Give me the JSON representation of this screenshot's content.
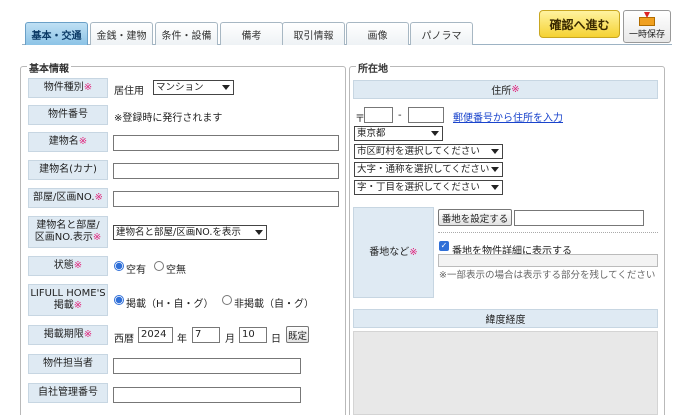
{
  "tabs": [
    {
      "label": "基本・交通",
      "active": true
    },
    {
      "label": "金銭・建物"
    },
    {
      "label": "条件・設備"
    },
    {
      "label": "備考"
    },
    {
      "label": "取引情報"
    },
    {
      "label": "画像"
    },
    {
      "label": "パノラマ"
    }
  ],
  "toolbar": {
    "confirm_label": "確認へ進む",
    "save_label": "一時保存"
  },
  "basic": {
    "legend": "基本情報",
    "property_type": {
      "label": "物件種別",
      "prefix": "居住用",
      "value": "マンション"
    },
    "property_number": {
      "label": "物件番号",
      "value": "※登録時に発行されます"
    },
    "building_name": {
      "label": "建物名",
      "value": ""
    },
    "building_name_kana": {
      "label": "建物名(カナ)",
      "value": ""
    },
    "room_number": {
      "label": "部屋/区画NO.",
      "value": ""
    },
    "display": {
      "label_line1": "建物名と部屋/",
      "label_line2": "区画NO.表示",
      "value": "建物名と部屋/区画NO.を表示"
    },
    "status": {
      "label": "状態",
      "opt1": "空有",
      "opt2": "空無"
    },
    "lifull": {
      "label_line1": "LIFULL HOME'S",
      "label_line2": "掲載",
      "opt1": "掲載（H・自・グ）",
      "opt2": "非掲載（自・グ）"
    },
    "period": {
      "label": "掲載期限",
      "era": "西暦",
      "year": "2024",
      "year_unit": "年",
      "month": "7",
      "month_unit": "月",
      "day": "10",
      "day_unit": "日",
      "default_btn": "既定"
    },
    "person": {
      "label": "物件担当者",
      "value": ""
    },
    "mgmt_no": {
      "label": "自社管理番号",
      "value": ""
    }
  },
  "location": {
    "legend": "所在地",
    "address_header": "住所",
    "zip_prefix": "〒",
    "zip1": "",
    "zip_dash": "-",
    "zip2": "",
    "zip_link": "郵便番号から住所を入力",
    "prefecture": "東京都",
    "city": "市区町村を選択してください",
    "district": "大字・通称を選択してください",
    "block": "字・丁目を選択してください",
    "banchi_label": "番地など",
    "banchi_btn": "番地を設定する",
    "banchi_value": "",
    "show_detail": "番地を物件詳細に表示する",
    "hidden_value": "",
    "note": "※一部表示の場合は表示する部分を残してください",
    "latlng_header": "緯度経度"
  },
  "required_mark": "※"
}
